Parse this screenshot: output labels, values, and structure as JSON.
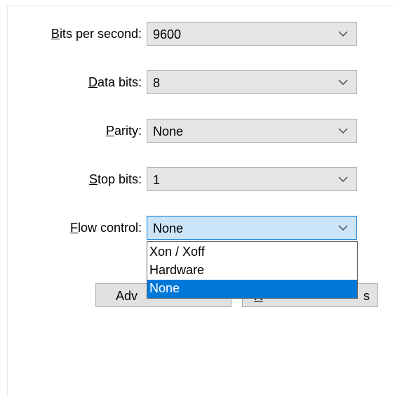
{
  "fields": [
    {
      "label_key": "B",
      "label_rest": "its per second:",
      "value": "9600"
    },
    {
      "label_key": "D",
      "label_rest": "ata bits:",
      "value": "8"
    },
    {
      "label_key": "P",
      "label_rest": "arity:",
      "value": "None"
    },
    {
      "label_key": "S",
      "label_rest": "top bits:",
      "value": "1"
    },
    {
      "label_key": "F",
      "label_rest": "low control:",
      "value": "None"
    }
  ],
  "flow_control_options": [
    {
      "label": "Xon / Xoff",
      "selected": false
    },
    {
      "label": "Hardware",
      "selected": false
    },
    {
      "label": "None",
      "selected": true
    }
  ],
  "buttons": {
    "advanced_label_visible": "Adv",
    "restore_label_key": "R",
    "restore_label_tail_visible": "s"
  },
  "icons": {
    "combo_arrow": "chevron-down-icon"
  },
  "colors": {
    "focus_border": "#0078d7",
    "focus_fill": "#cce4f7",
    "highlight": "#0078d7",
    "combo_fill": "#e5e5e5",
    "button_fill": "#e1e1e1"
  }
}
